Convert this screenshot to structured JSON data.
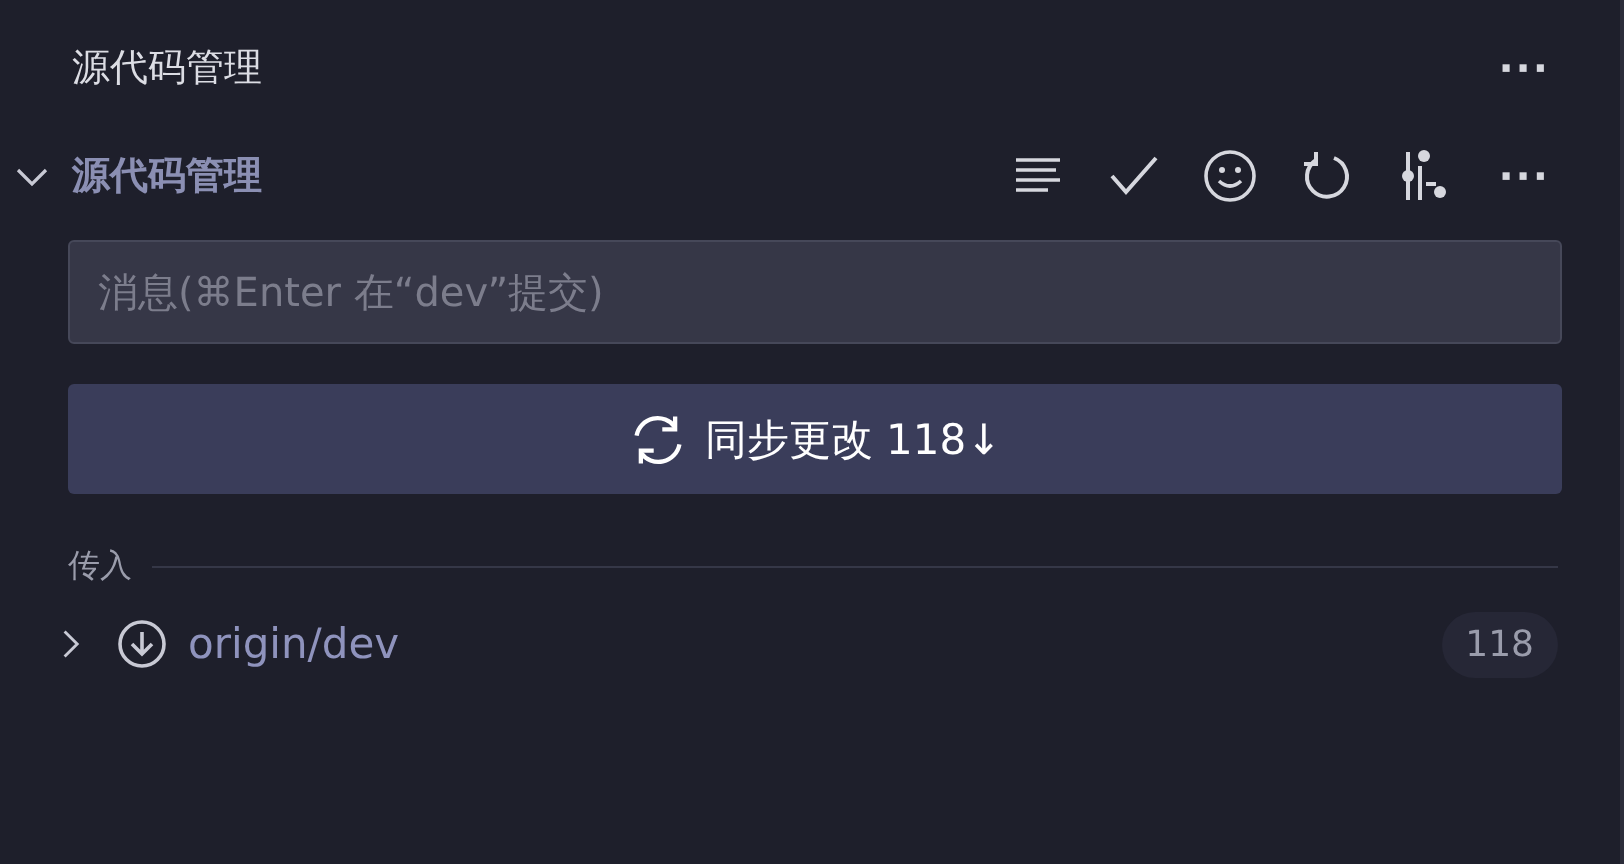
{
  "panel": {
    "title": "源代码管理",
    "more": "···"
  },
  "section": {
    "title": "源代码管理",
    "expanded": true,
    "actions": [
      {
        "kind": "lines"
      },
      {
        "kind": "check"
      },
      {
        "kind": "smile"
      },
      {
        "kind": "refresh"
      },
      {
        "kind": "graph"
      },
      {
        "kind": "more"
      }
    ]
  },
  "commit_input": {
    "placeholder": "消息(⌘Enter 在“dev”提交)"
  },
  "sync_button": {
    "label": "同步更改 118↓"
  },
  "incoming": {
    "label": "传入",
    "items": [
      {
        "name": "origin/dev",
        "count": "118",
        "expanded": false
      }
    ]
  }
}
